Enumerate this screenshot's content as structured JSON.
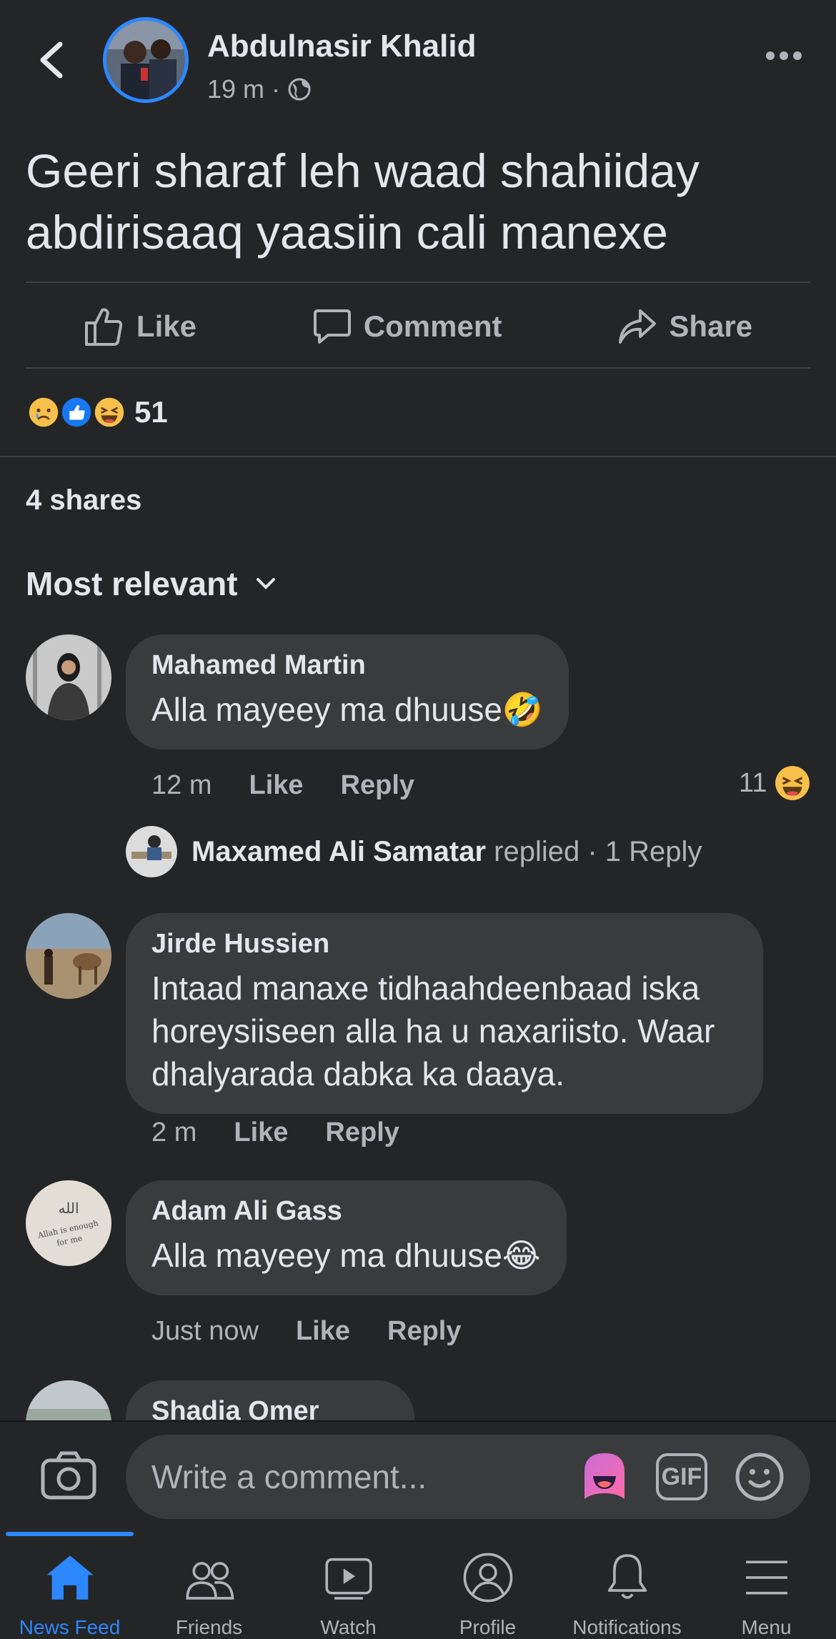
{
  "post": {
    "author": "Abdulnasir Khalid",
    "time": "19 m",
    "separator": "·",
    "text": "Geeri sharaf leh waad shahiiday abdirisaaq yaasiin cali manexe"
  },
  "actions": {
    "like": "Like",
    "comment": "Comment",
    "share": "Share"
  },
  "reactions": {
    "count": "51",
    "types": [
      "sad",
      "like",
      "haha"
    ]
  },
  "shares_label": "4 shares",
  "sort_label": "Most relevant",
  "comments": [
    {
      "name": "Mahamed Martin",
      "text": "Alla mayeey ma dhuuse🤣",
      "time": "12 m",
      "like": "Like",
      "reply": "Reply",
      "reaction_count": "11"
    },
    {
      "name": "Jirde Hussien",
      "text": "Intaad manaxe tidhaahdeenbaad iska horeysiiseen alla ha u naxariisto. Waar dhalyarada dabka ka daaya.",
      "time": "2 m",
      "like": "Like",
      "reply": "Reply"
    },
    {
      "name": "Adam Ali Gass",
      "text": "Alla mayeey ma dhuuse😂",
      "time": "Just now",
      "like": "Like",
      "reply": "Reply"
    },
    {
      "name": "Shadia Omer"
    }
  ],
  "reply_summary": {
    "name": "Maxamed Ali Samatar",
    "verb": "replied",
    "count": "· 1 Reply"
  },
  "composer": {
    "placeholder": "Write a comment...",
    "gif": "GIF"
  },
  "nav": [
    {
      "label": "News Feed",
      "icon": "home-icon",
      "active": true
    },
    {
      "label": "Friends",
      "icon": "friends-icon"
    },
    {
      "label": "Watch",
      "icon": "watch-icon"
    },
    {
      "label": "Profile",
      "icon": "profile-icon"
    },
    {
      "label": "Notifications",
      "icon": "bell-icon"
    },
    {
      "label": "Menu",
      "icon": "menu-icon"
    }
  ],
  "colors": {
    "accent": "#2d88ff",
    "background": "#242526",
    "bubble": "#3a3b3c"
  }
}
